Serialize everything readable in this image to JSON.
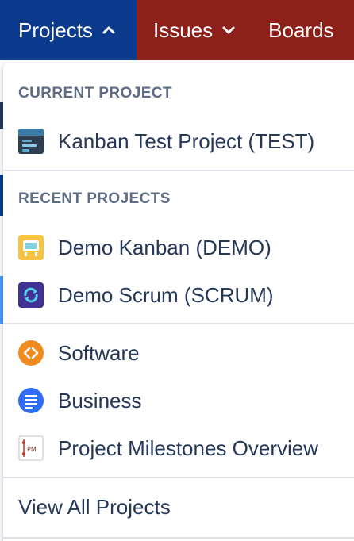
{
  "nav": {
    "projects_label": "Projects",
    "issues_label": "Issues",
    "boards_label": "Boards"
  },
  "dropdown": {
    "current_heading": "CURRENT PROJECT",
    "current_project": {
      "label": "Kanban Test Project (TEST)",
      "icon": "kanban-project-icon"
    },
    "recent_heading": "RECENT PROJECTS",
    "recent_projects": [
      {
        "label": "Demo Kanban (DEMO)",
        "icon": "demo-kanban-icon"
      },
      {
        "label": "Demo Scrum (SCRUM)",
        "icon": "demo-scrum-icon"
      }
    ],
    "project_types": [
      {
        "label": "Software",
        "icon": "software-icon"
      },
      {
        "label": "Business",
        "icon": "business-icon"
      },
      {
        "label": "Project Milestones Overview",
        "icon": "milestones-icon"
      }
    ],
    "view_all_label": "View All Projects"
  },
  "colors": {
    "projects_nav": "#0c3a8c",
    "nav_bar": "#8d2019",
    "heading_text": "#5e6c84",
    "item_text": "#253858"
  }
}
